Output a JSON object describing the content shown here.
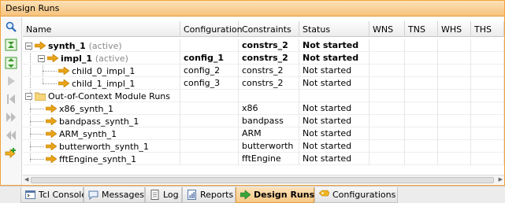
{
  "panel": {
    "title": "Design Runs"
  },
  "columns": [
    "Name",
    "Configuration",
    "Constraints",
    "Status",
    "WNS",
    "TNS",
    "WHS",
    "THS"
  ],
  "rows": [
    {
      "name": "synth_1",
      "suffix": "(active)",
      "config": "",
      "constraints": "constrs_2",
      "status": "Not started",
      "bold": true
    },
    {
      "name": "impl_1",
      "suffix": "(active)",
      "config": "config_1",
      "constraints": "constrs_2",
      "status": "Not started",
      "bold": true
    },
    {
      "name": "child_0_impl_1",
      "suffix": "",
      "config": "config_2",
      "constraints": "constrs_2",
      "status": "Not started",
      "bold": false
    },
    {
      "name": "child_1_impl_1",
      "suffix": "",
      "config": "config_3",
      "constraints": "constrs_2",
      "status": "Not started",
      "bold": false
    },
    {
      "name": "Out-of-Context Module Runs",
      "suffix": "",
      "config": "",
      "constraints": "",
      "status": "",
      "bold": false
    },
    {
      "name": "x86_synth_1",
      "suffix": "",
      "config": "",
      "constraints": "x86",
      "status": "Not started",
      "bold": false
    },
    {
      "name": "bandpass_synth_1",
      "suffix": "",
      "config": "",
      "constraints": "bandpass",
      "status": "Not started",
      "bold": false
    },
    {
      "name": "ARM_synth_1",
      "suffix": "",
      "config": "",
      "constraints": "ARM",
      "status": "Not started",
      "bold": false
    },
    {
      "name": "butterworth_synth_1",
      "suffix": "",
      "config": "",
      "constraints": "butterworth",
      "status": "Not started",
      "bold": false
    },
    {
      "name": "fftEngine_synth_1",
      "suffix": "",
      "config": "",
      "constraints": "fftEngine",
      "status": "Not started",
      "bold": false
    }
  ],
  "tabs": [
    "Tcl Console",
    "Messages",
    "Log",
    "Reports",
    "Design Runs",
    "Configurations"
  ],
  "active_tab": "Design Runs",
  "icons": {
    "toolbar": [
      "search-icon",
      "collapse-all-icon",
      "expand-all-icon",
      "launch-icon",
      "first-icon",
      "next-icon",
      "previous-icon",
      "add-run-icon"
    ],
    "tabs": [
      "console-icon",
      "messages-icon",
      "log-icon",
      "reports-icon",
      "design-runs-icon",
      "configurations-icon"
    ]
  },
  "colors": {
    "accent": "#f2a33c",
    "run_arrow": "#e8a317",
    "active_tab": "#f7c987"
  }
}
